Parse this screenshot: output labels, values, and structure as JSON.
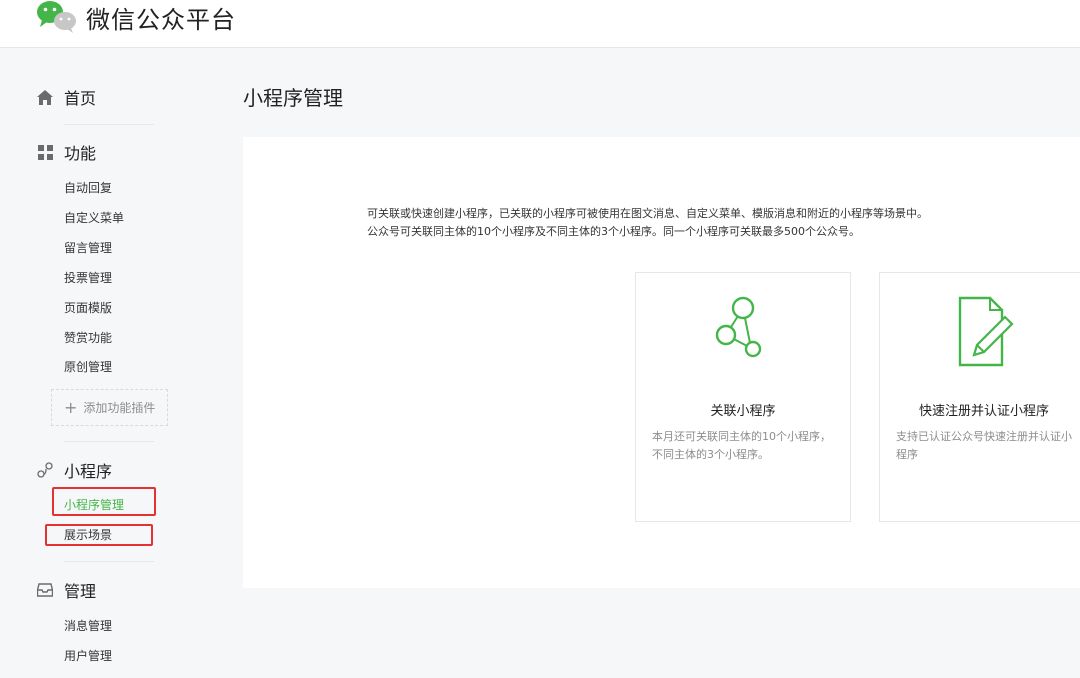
{
  "header": {
    "logo_text": "微信公众平台"
  },
  "sidebar": {
    "home": {
      "label": "首页"
    },
    "function": {
      "label": "功能",
      "items": [
        "自动回复",
        "自定义菜单",
        "留言管理",
        "投票管理",
        "页面模版",
        "赞赏功能",
        "原创管理"
      ],
      "add_plugin": "添加功能插件"
    },
    "miniprogram": {
      "label": "小程序",
      "items": [
        "小程序管理",
        "展示场景"
      ]
    },
    "manage": {
      "label": "管理",
      "items": [
        "消息管理",
        "用户管理"
      ]
    }
  },
  "main": {
    "title": "小程序管理",
    "desc_line1": "可关联或快速创建小程序，已关联的小程序可被使用在图文消息、自定义菜单、模版消息和附近的小程序等场景中。",
    "desc_line2": "公众号可关联同主体的10个小程序及不同主体的3个小程序。同一个小程序可关联最多500个公众号。",
    "cards": [
      {
        "title": "关联小程序",
        "text": "本月还可关联同主体的10个小程序，不同主体的3个小程序。",
        "icon": "link-nodes-icon"
      },
      {
        "title": "快速注册并认证小程序",
        "text": "支持已认证公众号快速注册并认证小程序",
        "icon": "document-pen-icon"
      }
    ]
  },
  "colors": {
    "accent": "#44b549",
    "highlight_box": "#e3322f",
    "background": "#f6f7f9"
  }
}
